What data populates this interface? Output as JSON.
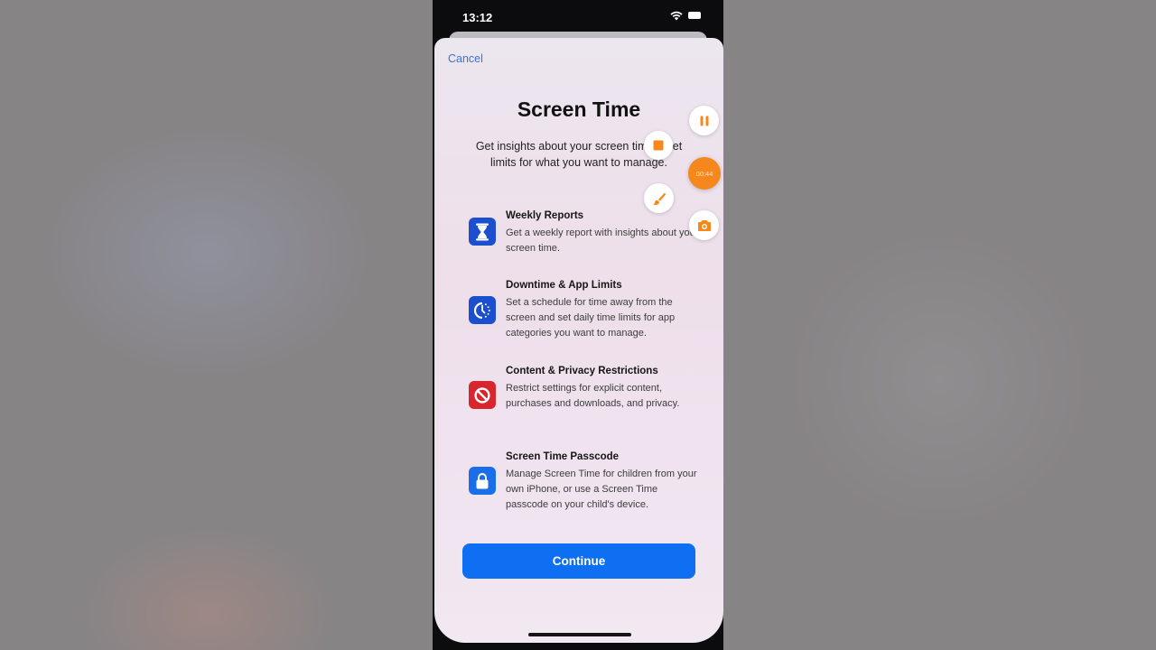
{
  "status_bar": {
    "time": "13:12",
    "icons": [
      "wifi-icon",
      "battery-icon"
    ]
  },
  "sheet": {
    "cancel_label": "Cancel",
    "title": "Screen Time",
    "subtitle_line1": "Get insights about your screen tim",
    "subtitle_line1_end": "set",
    "subtitle_line2": "limits for what you want to manage."
  },
  "features": [
    {
      "title": "Weekly Reports",
      "description": "Get a weekly report with insights about your screen time.",
      "icon": "hourglass-icon",
      "icon_color": "#1b4fcf"
    },
    {
      "title": "Downtime & App Limits",
      "description": "Set a schedule for time away from the screen and set daily time limits for app categories you want to manage.",
      "icon": "downtime-icon",
      "icon_color": "#1b4fcf"
    },
    {
      "title": "Content & Privacy Restrictions",
      "description": "Restrict settings for explicit content, purchases and downloads, and privacy.",
      "icon": "restriction-icon",
      "icon_color": "#d8262e"
    },
    {
      "title": "Screen Time Passcode",
      "description": "Manage Screen Time for children from your own iPhone, or use a Screen Time passcode on your child's device.",
      "icon": "lock-icon",
      "icon_color": "#1a6ee8"
    }
  ],
  "continue_label": "Continue",
  "recorder_overlay": {
    "timer": "00:44",
    "accent_color": "#f5871c",
    "icons": [
      "pause-icon",
      "stop-icon",
      "brush-icon",
      "screenshot-icon"
    ]
  }
}
